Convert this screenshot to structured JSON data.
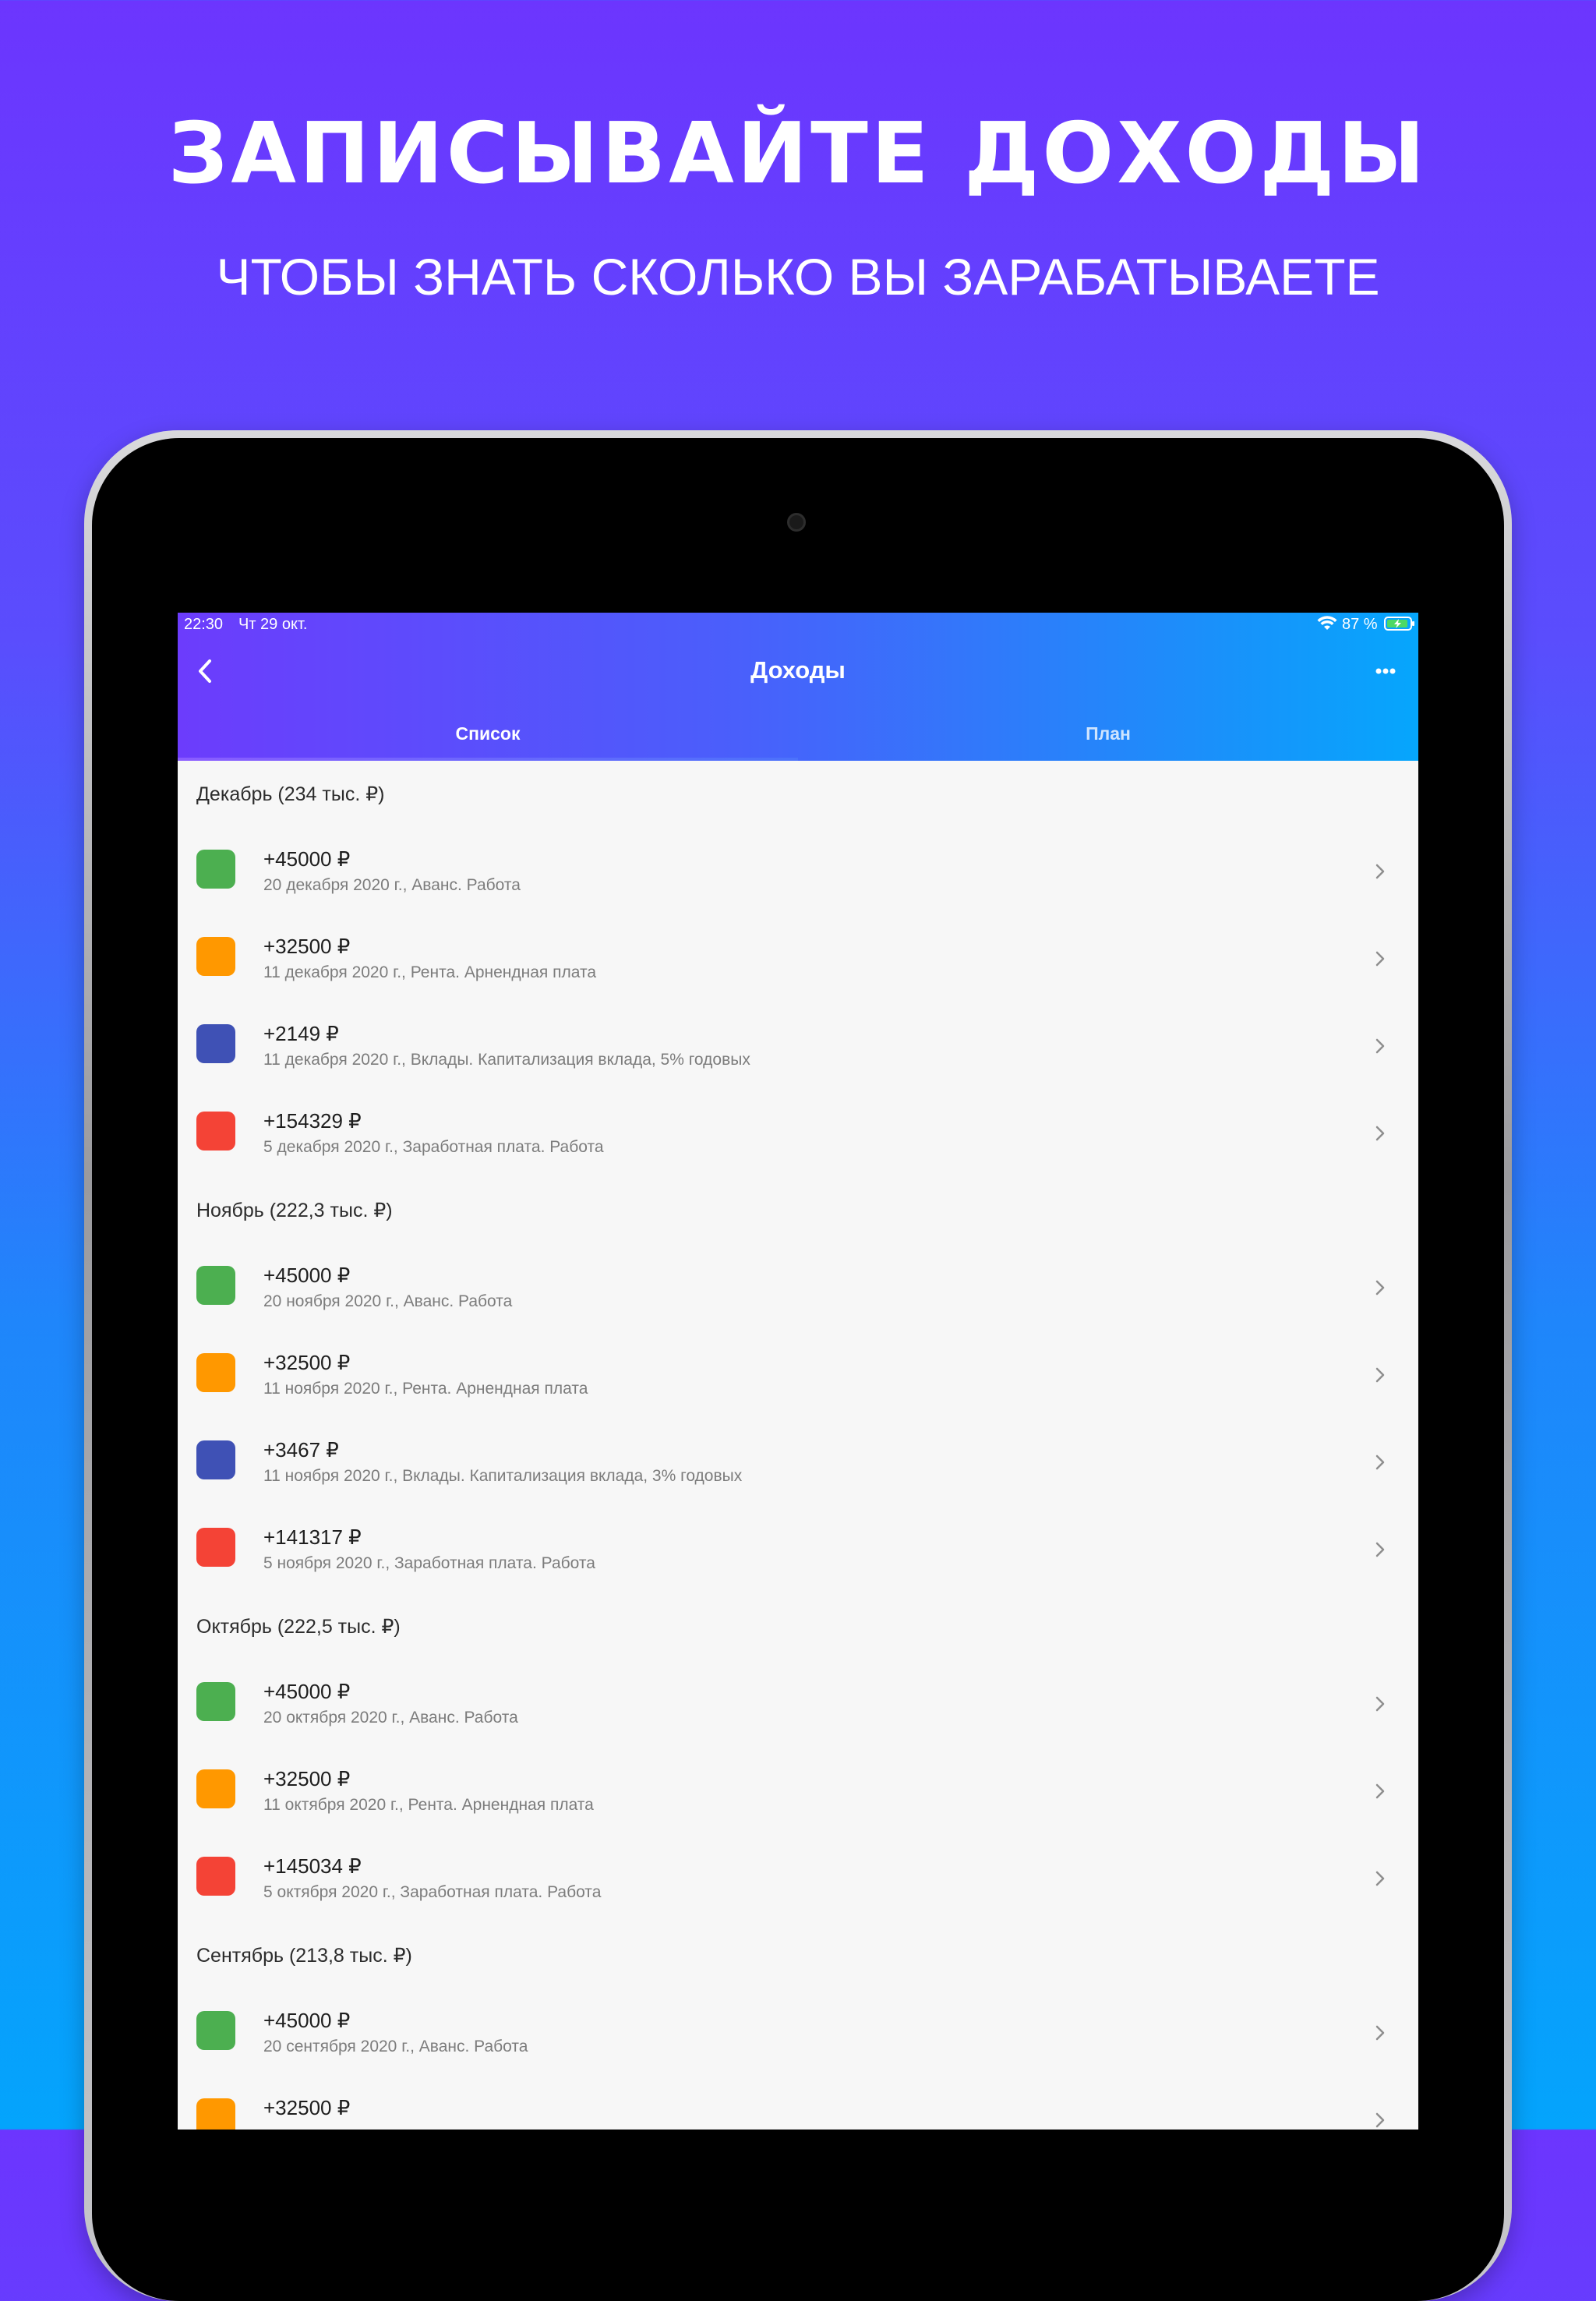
{
  "promo": {
    "title": "ЗАПИСЫВАЙТЕ ДОХОДЫ",
    "subtitle": "ЧТОБЫ ЗНАТЬ СКОЛЬКО ВЫ ЗАРАБАТЫВАЕТЕ"
  },
  "status_bar": {
    "time": "22:30",
    "date": "Чт 29 окт.",
    "battery": "87 %"
  },
  "nav": {
    "title": "Доходы",
    "back_icon": "chevron-left-icon",
    "more_icon": "ellipsis-icon"
  },
  "tabs": [
    {
      "label": "Список",
      "selected": true
    },
    {
      "label": "План",
      "selected": false
    }
  ],
  "colors": {
    "green": "#4caf50",
    "orange": "#ff9800",
    "blue": "#3f51b5",
    "red": "#f44336",
    "accent_start": "#6c3cfc",
    "accent_end": "#06a6fc"
  },
  "sections": [
    {
      "title": "Декабрь (234 тыс. ₽)",
      "items": [
        {
          "amount": "+45000 ₽",
          "details": "20 декабря 2020 г., Аванс. Работа",
          "color": "#4caf50"
        },
        {
          "amount": "+32500 ₽",
          "details": "11 декабря 2020 г., Рента. Арнендная плата",
          "color": "#ff9800"
        },
        {
          "amount": "+2149 ₽",
          "details": "11 декабря 2020 г., Вклады. Капитализация вклада, 5% годовых",
          "color": "#3f51b5"
        },
        {
          "amount": "+154329 ₽",
          "details": "5 декабря 2020 г., Заработная плата. Работа",
          "color": "#f44336"
        }
      ]
    },
    {
      "title": "Ноябрь (222,3 тыс. ₽)",
      "items": [
        {
          "amount": "+45000 ₽",
          "details": "20 ноября 2020 г., Аванс. Работа",
          "color": "#4caf50"
        },
        {
          "amount": "+32500 ₽",
          "details": "11 ноября 2020 г., Рента. Арнендная плата",
          "color": "#ff9800"
        },
        {
          "amount": "+3467 ₽",
          "details": "11 ноября 2020 г., Вклады. Капитализация вклада, 3% годовых",
          "color": "#3f51b5"
        },
        {
          "amount": "+141317 ₽",
          "details": "5 ноября 2020 г., Заработная плата. Работа",
          "color": "#f44336"
        }
      ]
    },
    {
      "title": "Октябрь (222,5 тыс. ₽)",
      "items": [
        {
          "amount": "+45000 ₽",
          "details": "20 октября 2020 г., Аванс. Работа",
          "color": "#4caf50"
        },
        {
          "amount": "+32500 ₽",
          "details": "11 октября 2020 г., Рента. Арнендная плата",
          "color": "#ff9800"
        },
        {
          "amount": "+145034 ₽",
          "details": "5 октября 2020 г., Заработная плата. Работа",
          "color": "#f44336"
        }
      ]
    },
    {
      "title": "Сентябрь (213,8 тыс. ₽)",
      "items": [
        {
          "amount": "+45000 ₽",
          "details": "20 сентября 2020 г., Аванс. Работа",
          "color": "#4caf50"
        },
        {
          "amount": "+32500 ₽",
          "details": "",
          "color": "#ff9800"
        }
      ]
    }
  ]
}
